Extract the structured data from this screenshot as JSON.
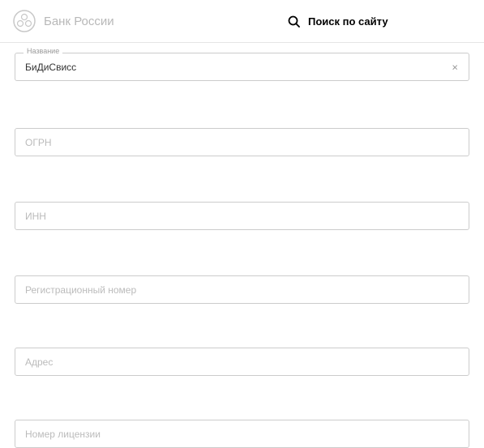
{
  "header": {
    "logo_text": "Банк России",
    "search_text": "Поиск по сайту"
  },
  "form": {
    "name": {
      "label": "Название",
      "value": "БиДиСвисс",
      "clear_symbol": "×"
    },
    "ogrn": {
      "placeholder": "ОГРН"
    },
    "inn": {
      "placeholder": "ИНН"
    },
    "reg_number": {
      "placeholder": "Регистрационный номер"
    },
    "address": {
      "placeholder": "Адрес"
    },
    "license": {
      "placeholder": "Номер лицензии"
    }
  }
}
